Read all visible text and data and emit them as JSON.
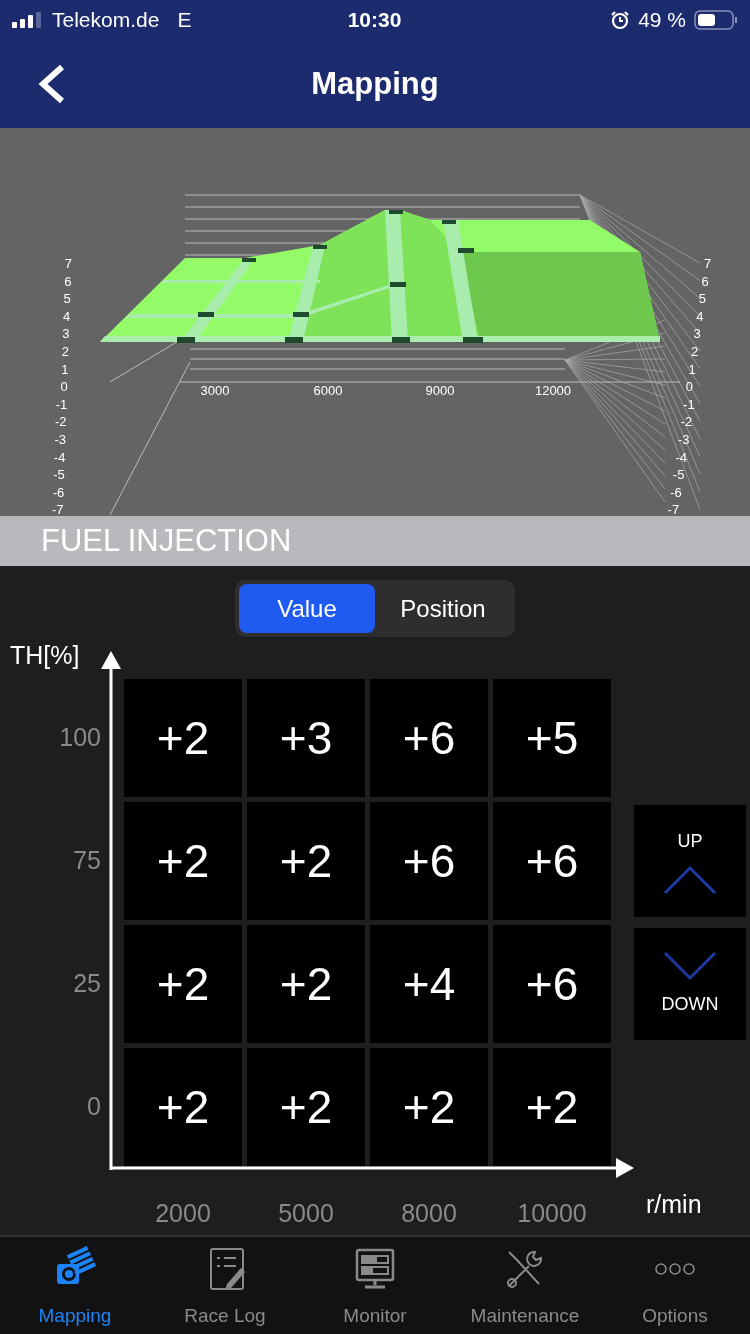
{
  "status_bar": {
    "carrier": "Telekom.de",
    "network": "E",
    "time": "10:30",
    "battery": "49 %"
  },
  "nav": {
    "title": "Mapping"
  },
  "chart": {
    "left_ticks": [
      "7",
      "6",
      "5",
      "4",
      "3",
      "2",
      "1",
      "0",
      "-1",
      "-2",
      "-3",
      "-4",
      "-5",
      "-6",
      "-7"
    ],
    "right_ticks": [
      "7",
      "6",
      "5",
      "4",
      "3",
      "2",
      "1",
      "0",
      "-1",
      "-2",
      "-3",
      "-4",
      "-5",
      "-6",
      "-7"
    ],
    "x_ticks": [
      "3000",
      "6000",
      "9000",
      "12000"
    ]
  },
  "section": {
    "title": "FUEL INJECTION"
  },
  "mode_tabs": [
    {
      "label": "Value",
      "selected": true
    },
    {
      "label": "Position",
      "selected": false
    }
  ],
  "map": {
    "y_axis_label": "TH[%]",
    "x_axis_label": "r/min",
    "rows": [
      {
        "label": "100",
        "cells": [
          "+2",
          "+3",
          "+6",
          "+5"
        ]
      },
      {
        "label": "75",
        "cells": [
          "+2",
          "+2",
          "+6",
          "+6"
        ]
      },
      {
        "label": "25",
        "cells": [
          "+2",
          "+2",
          "+4",
          "+6"
        ]
      },
      {
        "label": "0",
        "cells": [
          "+2",
          "+2",
          "+2",
          "+2"
        ]
      }
    ],
    "rpm_labels": [
      "2000",
      "5000",
      "8000",
      "10000"
    ]
  },
  "adjust_buttons": [
    {
      "label": "UP",
      "kind": "up"
    },
    {
      "label": "DOWN",
      "kind": "down"
    }
  ],
  "tab_bar": [
    {
      "label": "Mapping",
      "selected": true
    },
    {
      "label": "Race Log",
      "selected": false
    },
    {
      "label": "Monitor",
      "selected": false
    },
    {
      "label": "Maintenance",
      "selected": false
    },
    {
      "label": "Options",
      "selected": false
    }
  ]
}
